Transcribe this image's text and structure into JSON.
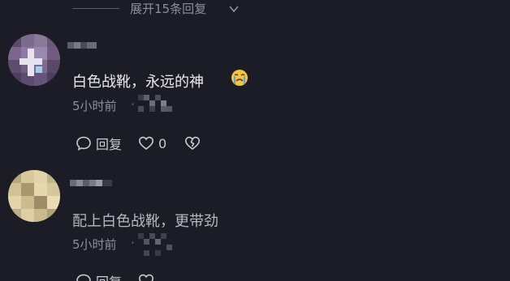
{
  "thread": {
    "expand_label": "展开15条回复"
  },
  "comments": [
    {
      "text": "白色战靴，永远的神",
      "emoji": "crying-face-icon",
      "time": "5小时前",
      "reply_label": "回复",
      "like_count": "0"
    },
    {
      "text": "配上白色战靴，更带劲",
      "time": "5小时前",
      "reply_label": "回复"
    }
  ],
  "colors": {
    "background": "#1b1c26",
    "primary_text": "#e9e9ee",
    "secondary_text": "#8e8f98"
  }
}
